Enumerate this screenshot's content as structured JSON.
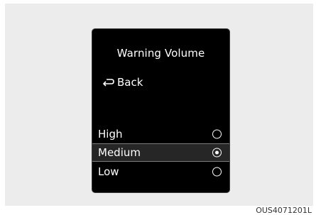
{
  "screen": {
    "title": "Warning Volume",
    "back_label": "Back",
    "back_icon": "back-arrow-icon",
    "options": [
      {
        "label": "High",
        "selected": false
      },
      {
        "label": "Medium",
        "selected": true
      },
      {
        "label": "Low",
        "selected": false
      }
    ]
  },
  "caption": "OUS4071201L",
  "colors": {
    "screen_bg": "#000000",
    "text": "#ffffff",
    "highlight_bg": "#262626",
    "highlight_border": "#7c7c7c",
    "frame_bg": "#ececec"
  }
}
